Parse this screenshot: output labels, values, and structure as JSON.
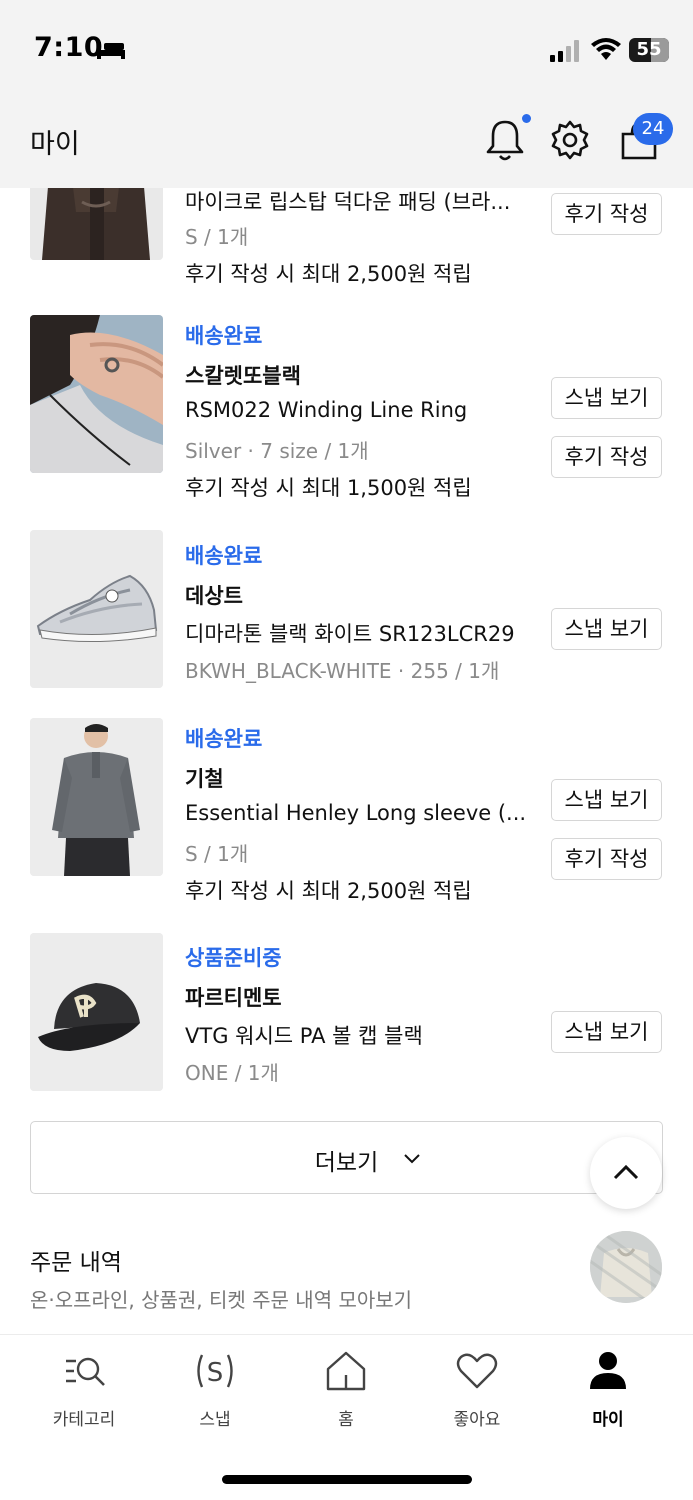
{
  "status_bar": {
    "time": "7:10",
    "battery": "55",
    "battery_level_percent": 55
  },
  "header": {
    "title": "마이",
    "cart_count": "24"
  },
  "items": [
    {
      "status": "",
      "brand": "",
      "name": "마이크로 립스탑 덕다운 패딩 (브라...",
      "option": "S / 1개",
      "reward": "후기 작성 시 최대 2,500원 적립",
      "buttons": [
        "후기 작성"
      ]
    },
    {
      "status": "배송완료",
      "brand": "스칼렛또블랙",
      "name": "RSM022 Winding Line Ring",
      "option": "Silver · 7 size / 1개",
      "reward": "후기 작성 시 최대 1,500원 적립",
      "buttons": [
        "스냅 보기",
        "후기 작성"
      ]
    },
    {
      "status": "배송완료",
      "brand": "데상트",
      "name": "디마라톤 블랙 화이트 SR123LCR29",
      "option": "BKWH_BLACK-WHITE · 255 / 1개",
      "reward": "",
      "buttons": [
        "스냅 보기"
      ]
    },
    {
      "status": "배송완료",
      "brand": "기철",
      "name": "Essential Henley Long sleeve (...",
      "option": "S / 1개",
      "reward": "후기 작성 시 최대 2,500원 적립",
      "buttons": [
        "스냅 보기",
        "후기 작성"
      ]
    },
    {
      "status": "상품준비중",
      "brand": "파르티멘토",
      "name": "VTG 워시드 PA 볼 캡 블랙",
      "option": "ONE / 1개",
      "reward": "",
      "buttons": [
        "스냅 보기"
      ]
    }
  ],
  "more_button": {
    "label": "더보기"
  },
  "orders": {
    "title": "주문 내역",
    "subtitle": "온·오프라인, 상품권, 티켓 주문 내역 모아보기"
  },
  "tabbar": [
    {
      "label": "카테고리",
      "icon": "category-search-icon"
    },
    {
      "label": "스냅",
      "icon": "snap-icon"
    },
    {
      "label": "홈",
      "icon": "home-icon"
    },
    {
      "label": "좋아요",
      "icon": "heart-icon"
    },
    {
      "label": "마이",
      "icon": "person-icon",
      "active": true
    }
  ],
  "colors": {
    "accent": "#2a6bea",
    "header_bg": "#f3f3f3",
    "muted_text": "#8a8a8a"
  }
}
